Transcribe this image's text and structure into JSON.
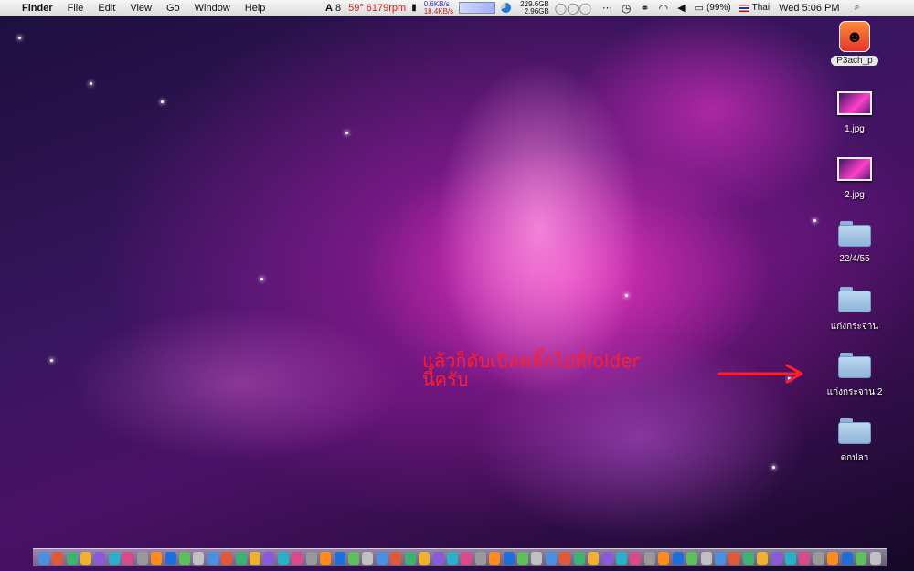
{
  "menubar": {
    "apple": "",
    "app_name": "Finder",
    "menus": [
      "File",
      "Edit",
      "View",
      "Go",
      "Window",
      "Help"
    ],
    "status": {
      "adobe_badge": "8",
      "temp_fan": "59° 6179rpm",
      "net_up": "0.6KB/s",
      "net_down": "18.4KB/s",
      "disk_total": "229.6GB",
      "disk_free": "2.96GB",
      "battery": "(99%)",
      "input_lang": "Thai",
      "clock": "Wed 5:06 PM"
    }
  },
  "desktop_icons": [
    {
      "label": "P3ach_p",
      "kind": "app"
    },
    {
      "label": "1.jpg",
      "kind": "image"
    },
    {
      "label": "2.jpg",
      "kind": "image"
    },
    {
      "label": "22/4/55",
      "kind": "folder"
    },
    {
      "label": "แก่งกระจาน",
      "kind": "folder"
    },
    {
      "label": "แก่งกระจาน 2",
      "kind": "folder"
    },
    {
      "label": "ตกปลา",
      "kind": "folder"
    }
  ],
  "annotation": {
    "line1": "แล้วก็ดับเบิลคลิ๊กไปที่folder",
    "line2": "นี้ครับ",
    "color": "#ff1f2b"
  },
  "colors": {
    "menubar": "#e6e6e6",
    "folder": "#a9c8e6",
    "annotation": "#ff1f2b"
  }
}
